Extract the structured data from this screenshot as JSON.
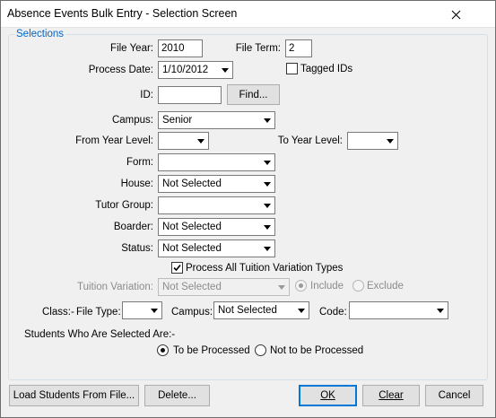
{
  "window": {
    "title": "Absence Events Bulk Entry - Selection Screen"
  },
  "group": {
    "caption": "Selections"
  },
  "fields": {
    "file_year": {
      "label": "File Year:",
      "value": "2010"
    },
    "file_term": {
      "label": "File Term:",
      "value": "2"
    },
    "process_date": {
      "label": "Process Date:",
      "value": "1/10/2012"
    },
    "tagged_ids": {
      "label": "Tagged IDs",
      "checked": false
    },
    "id": {
      "label": "ID:",
      "value": ""
    },
    "find_button": {
      "label": "Find..."
    },
    "campus": {
      "label": "Campus:",
      "value": "Senior"
    },
    "from_year_level": {
      "label": "From Year Level:",
      "value": ""
    },
    "to_year_level": {
      "label": "To Year Level:",
      "value": ""
    },
    "form": {
      "label": "Form:",
      "value": ""
    },
    "house": {
      "label": "House:",
      "value": "Not Selected"
    },
    "tutor_group": {
      "label": "Tutor Group:",
      "value": ""
    },
    "boarder": {
      "label": "Boarder:",
      "value": "Not Selected"
    },
    "status": {
      "label": "Status:",
      "value": "Not Selected"
    },
    "process_all_tuition": {
      "label": "Process All Tuition Variation Types",
      "checked": true
    },
    "tuition_variation": {
      "label": "Tuition Variation:",
      "value": "Not Selected"
    },
    "tuition_include": {
      "label": "Include",
      "selected": true
    },
    "tuition_exclude": {
      "label": "Exclude",
      "selected": false
    },
    "class_prefix": {
      "label": "Class:-"
    },
    "file_type": {
      "label": "File Type:",
      "value": ""
    },
    "class_campus": {
      "label": "Campus:",
      "value": "Not Selected"
    },
    "code": {
      "label": "Code:",
      "value": ""
    }
  },
  "students": {
    "heading": "Students Who Are Selected Are:-",
    "to_be_processed": {
      "label": "To be Processed",
      "selected": true
    },
    "not_to_be_processed": {
      "label": "Not to be Processed",
      "selected": false
    }
  },
  "buttons": {
    "load": "Load Students From File...",
    "delete": "Delete...",
    "ok": "OK",
    "clear": "Clear",
    "cancel": "Cancel"
  },
  "icons": {
    "close": "close-icon",
    "dropdown": "chevron-down-icon",
    "check": "check-icon",
    "radio": "radio-dot-icon"
  },
  "colors": {
    "caption": "#0066cc",
    "primary_border": "#0078d7",
    "window_bg": "#f0f0f0"
  }
}
